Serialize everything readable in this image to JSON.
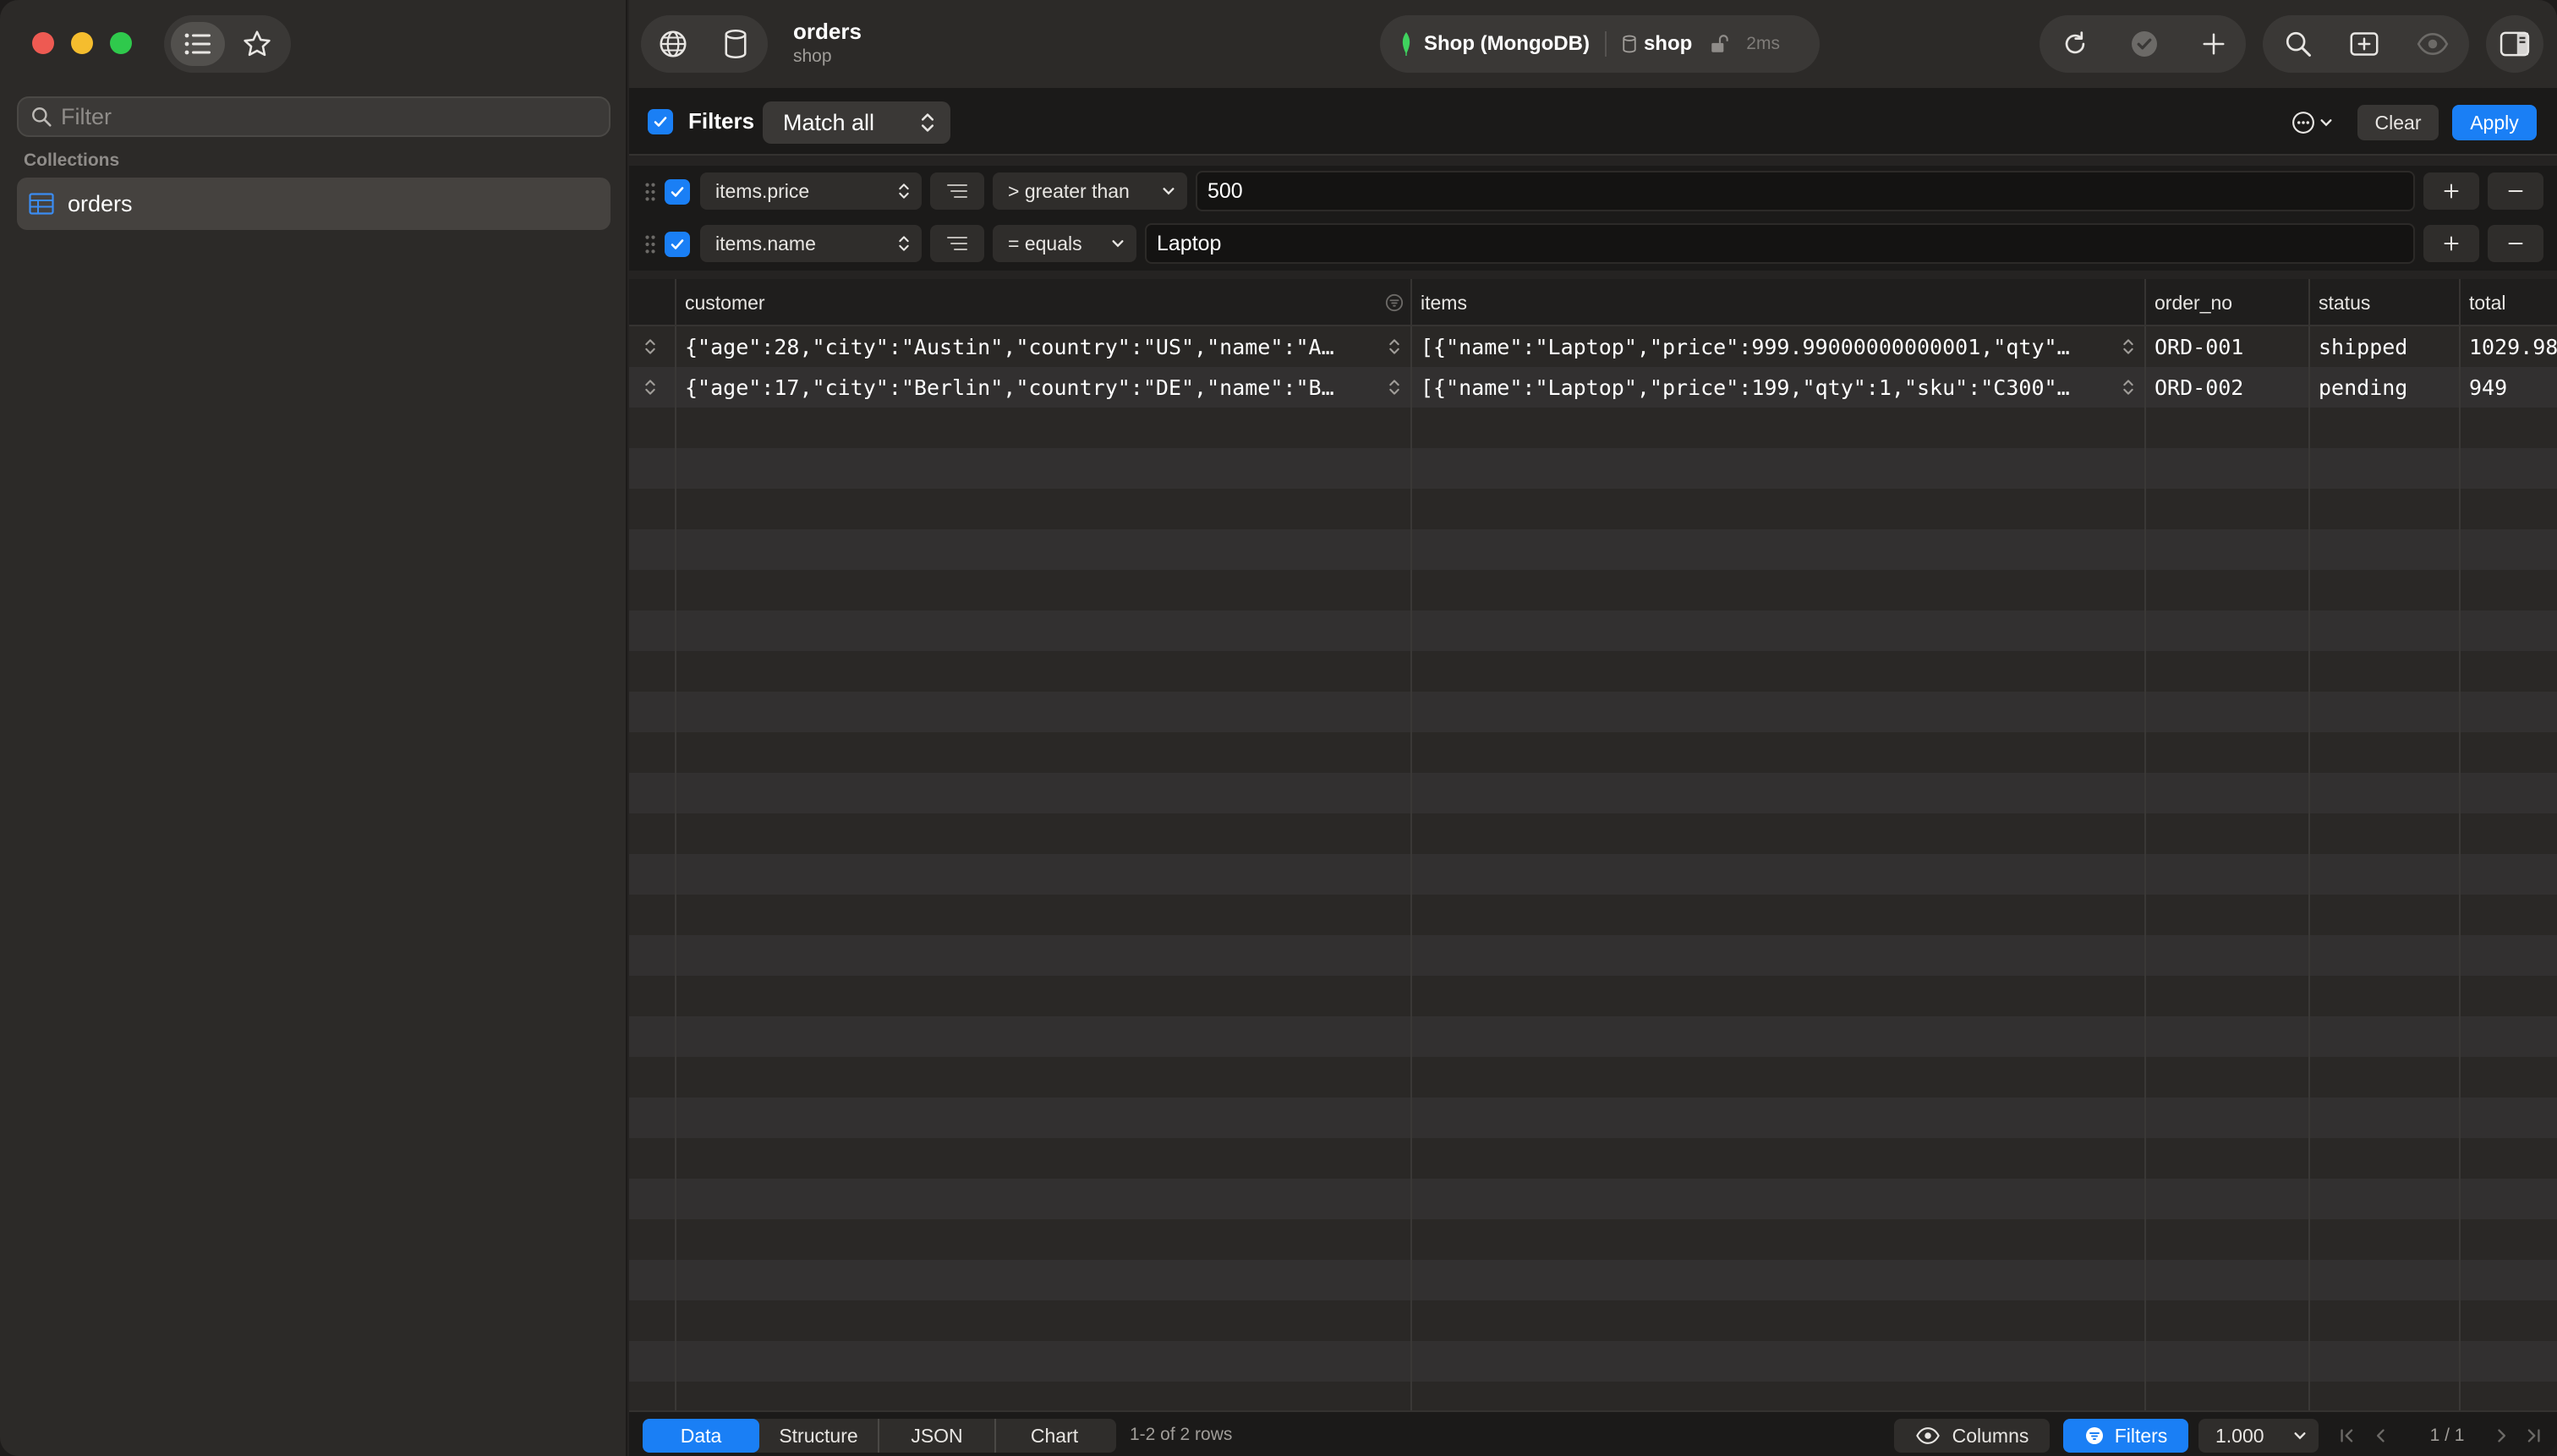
{
  "window": {
    "title": "orders",
    "subtitle": "shop"
  },
  "sidebar": {
    "filter_placeholder": "Filter",
    "section_title": "Collections",
    "items": [
      {
        "label": "orders",
        "selected": true
      }
    ]
  },
  "toolbar": {
    "connection_name": "Shop (MongoDB)",
    "database": "shop",
    "latency": "2ms"
  },
  "filters": {
    "enabled": true,
    "label": "Filters",
    "match_mode": "Match all",
    "clear_label": "Clear",
    "apply_label": "Apply",
    "rows": [
      {
        "field": "items.price",
        "operator": "> greater than",
        "value": "500"
      },
      {
        "field": "items.name",
        "operator": "= equals",
        "value": "Laptop"
      }
    ]
  },
  "table": {
    "columns": [
      "customer",
      "items",
      "order_no",
      "status",
      "total"
    ],
    "rows": [
      {
        "customer": "{\"age\":28,\"city\":\"Austin\",\"country\":\"US\",\"name\":\"A…",
        "items": "[{\"name\":\"Laptop\",\"price\":999.99000000000001,\"qty\"…",
        "order_no": "ORD-001",
        "status": "shipped",
        "total": "1029.98"
      },
      {
        "customer": "{\"age\":17,\"city\":\"Berlin\",\"country\":\"DE\",\"name\":\"B…",
        "items": "[{\"name\":\"Laptop\",\"price\":199,\"qty\":1,\"sku\":\"C300\"…",
        "order_no": "ORD-002",
        "status": "pending",
        "total": "949"
      }
    ]
  },
  "footer": {
    "tabs": [
      "Data",
      "Structure",
      "JSON",
      "Chart"
    ],
    "active_tab": "Data",
    "row_count": "1-2 of 2 rows",
    "columns_label": "Columns",
    "filters_label": "Filters",
    "page_size": "1.000",
    "page_indicator": "1 / 1"
  },
  "colors": {
    "accent": "#1a7ff5",
    "mongo_leaf": "#3fd35e",
    "window_bg": "#252322"
  }
}
